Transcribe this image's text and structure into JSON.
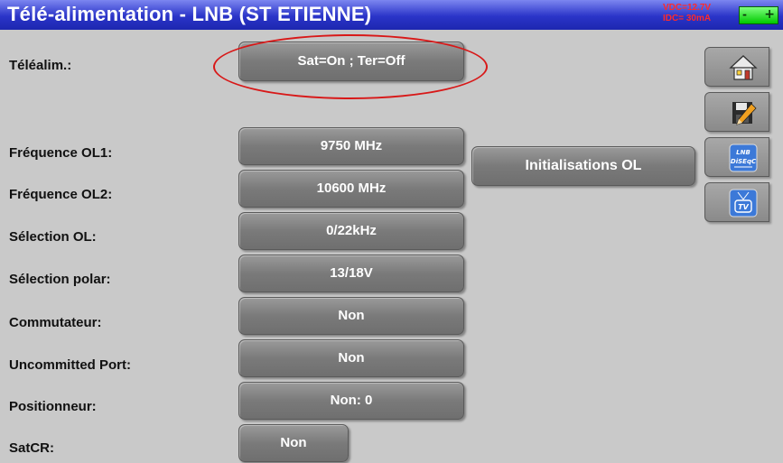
{
  "header": {
    "title": "Télé-alimentation - LNB (ST ETIENNE)",
    "vdc": "VDC=12.7V",
    "idc": "IDC= 30mA",
    "battery_minus": "-",
    "battery_plus": "+"
  },
  "rows": [
    {
      "label": "Téléalim.:",
      "value": "Sat=On ; Ter=Off"
    },
    {
      "label": "Fréquence OL1:",
      "value": "9750 MHz"
    },
    {
      "label": "Fréquence OL2:",
      "value": "10600 MHz"
    },
    {
      "label": "Sélection OL:",
      "value": "0/22kHz"
    },
    {
      "label": "Sélection polar:",
      "value": "13/18V"
    },
    {
      "label": "Commutateur:",
      "value": "Non"
    },
    {
      "label": "Uncommitted Port:",
      "value": "Non"
    },
    {
      "label": "Positionneur:",
      "value": "Non: 0"
    },
    {
      "label": "SatCR:",
      "value": "Non"
    }
  ],
  "init_ol_button": "Initialisations OL",
  "side_icons": [
    "home-icon",
    "save-edit-icon",
    "lnb-diseqc-icon",
    "tv-antenna-icon"
  ],
  "side_text": {
    "lnb": "LNB",
    "diseqc": "DiSEqC",
    "tv": "TV"
  },
  "colors": {
    "titlebar": "#2a34c8",
    "highlight_ellipse": "#d81818",
    "battery": "#00c800"
  }
}
